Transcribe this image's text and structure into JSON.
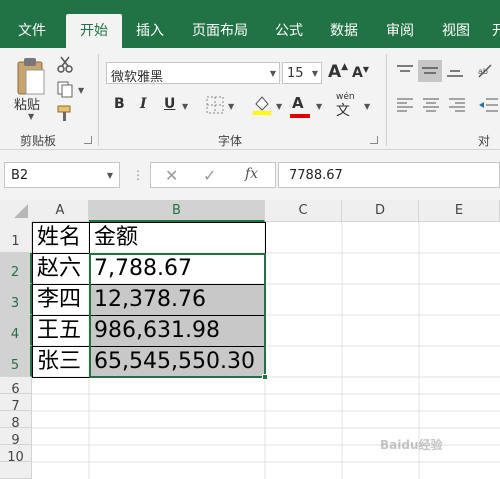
{
  "ribbon_tabs": [
    "文件",
    "开始",
    "插入",
    "页面布局",
    "公式",
    "数据",
    "审阅",
    "视图",
    "开"
  ],
  "active_tab_index": 1,
  "clipboard": {
    "paste_label": "粘贴",
    "group_label": "剪贴板"
  },
  "font": {
    "name": "微软雅黑",
    "size": "15",
    "group_label": "字体",
    "bold": "B",
    "italic": "I",
    "underline": "U",
    "wen": "wén",
    "wen_char": "文",
    "font_color_letter": "A",
    "grow": "A",
    "shrink": "A"
  },
  "alignment": {
    "group_label": "对齐"
  },
  "formula_bar": {
    "name_box": "B2",
    "fx": "fx",
    "value": "7788.67"
  },
  "columns": [
    "A",
    "B",
    "C",
    "D",
    "E"
  ],
  "rows": [
    "1",
    "2",
    "3",
    "4",
    "5",
    "6",
    "7",
    "8",
    "9",
    "10"
  ],
  "selected_column": "B",
  "selected_rows": [
    "2",
    "3",
    "4",
    "5"
  ],
  "table": {
    "header": {
      "name": "姓名",
      "amount": "金额"
    },
    "rows": [
      {
        "name": "赵六",
        "amount": "7,788.67"
      },
      {
        "name": "李四",
        "amount": "12,378.76"
      },
      {
        "name": "王五",
        "amount": "986,631.98"
      },
      {
        "name": "张三",
        "amount": "65,545,550.30"
      }
    ]
  },
  "colors": {
    "accent": "#217346",
    "selection": "#c8c8c8",
    "highlight_yellow": "#ffff00",
    "font_red": "#e00000"
  },
  "watermark": "Baidu经验"
}
